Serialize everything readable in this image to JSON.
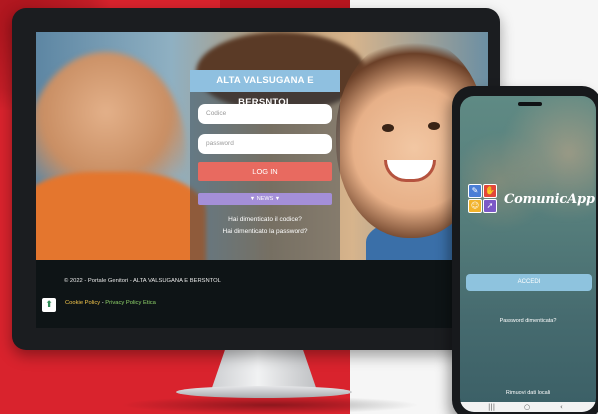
{
  "desktop": {
    "login": {
      "title": "ALTA VALSUGANA E BERSNTOL",
      "username_placeholder": "Codice",
      "password_placeholder": "password",
      "login_button": "LOG IN",
      "news_button": "▼ NEWS ▼",
      "forgot_code": "Hai dimenticato il codice?",
      "forgot_password": "Hai dimenticato la password?"
    },
    "footer": {
      "copyright": "© 2022 - Portale Genitori - ALTA VALSUGANA E BERSNTOL",
      "cookie_policy": "Cookie Policy",
      "separator": " - ",
      "privacy_policy": "Privacy Policy Etica"
    }
  },
  "phone": {
    "app_name": "ComunicApp",
    "accedi_button": "ACCEDI",
    "forgot_password": "Password dimenticata?",
    "remove_data": "Rimuovi dati locali"
  },
  "colors": {
    "header_blue": "#8fc0e0",
    "login_red": "#e86a60",
    "news_purple": "#a48fd8",
    "brand_red": "#d9232d"
  },
  "icons": [
    "scroll-top-icon",
    "app-logo-icon",
    "nav-recent-icon",
    "nav-home-icon",
    "nav-back-icon"
  ]
}
